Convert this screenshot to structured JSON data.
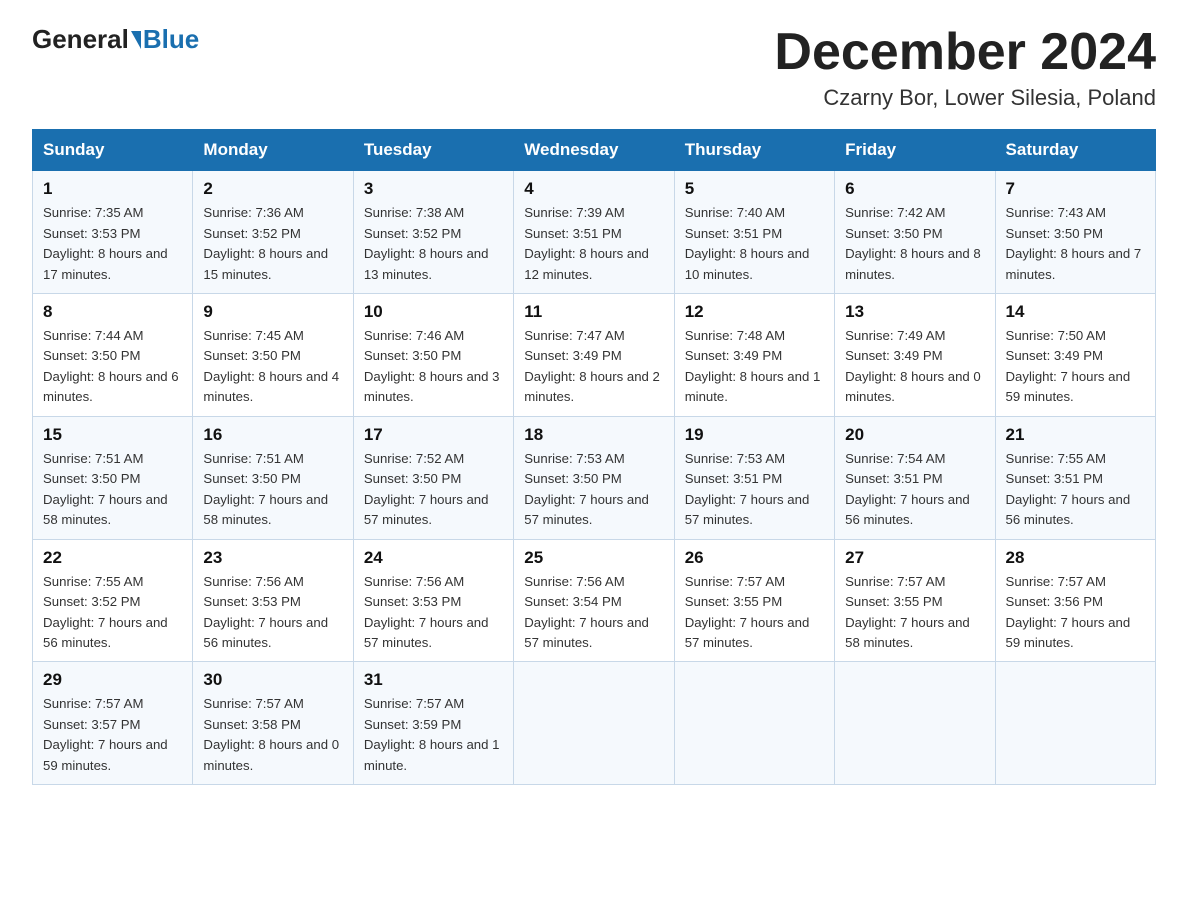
{
  "logo": {
    "general": "General",
    "blue": "Blue"
  },
  "title": "December 2024",
  "subtitle": "Czarny Bor, Lower Silesia, Poland",
  "weekdays": [
    "Sunday",
    "Monday",
    "Tuesday",
    "Wednesday",
    "Thursday",
    "Friday",
    "Saturday"
  ],
  "weeks": [
    [
      {
        "day": "1",
        "sunrise": "7:35 AM",
        "sunset": "3:53 PM",
        "daylight": "8 hours and 17 minutes."
      },
      {
        "day": "2",
        "sunrise": "7:36 AM",
        "sunset": "3:52 PM",
        "daylight": "8 hours and 15 minutes."
      },
      {
        "day": "3",
        "sunrise": "7:38 AM",
        "sunset": "3:52 PM",
        "daylight": "8 hours and 13 minutes."
      },
      {
        "day": "4",
        "sunrise": "7:39 AM",
        "sunset": "3:51 PM",
        "daylight": "8 hours and 12 minutes."
      },
      {
        "day": "5",
        "sunrise": "7:40 AM",
        "sunset": "3:51 PM",
        "daylight": "8 hours and 10 minutes."
      },
      {
        "day": "6",
        "sunrise": "7:42 AM",
        "sunset": "3:50 PM",
        "daylight": "8 hours and 8 minutes."
      },
      {
        "day": "7",
        "sunrise": "7:43 AM",
        "sunset": "3:50 PM",
        "daylight": "8 hours and 7 minutes."
      }
    ],
    [
      {
        "day": "8",
        "sunrise": "7:44 AM",
        "sunset": "3:50 PM",
        "daylight": "8 hours and 6 minutes."
      },
      {
        "day": "9",
        "sunrise": "7:45 AM",
        "sunset": "3:50 PM",
        "daylight": "8 hours and 4 minutes."
      },
      {
        "day": "10",
        "sunrise": "7:46 AM",
        "sunset": "3:50 PM",
        "daylight": "8 hours and 3 minutes."
      },
      {
        "day": "11",
        "sunrise": "7:47 AM",
        "sunset": "3:49 PM",
        "daylight": "8 hours and 2 minutes."
      },
      {
        "day": "12",
        "sunrise": "7:48 AM",
        "sunset": "3:49 PM",
        "daylight": "8 hours and 1 minute."
      },
      {
        "day": "13",
        "sunrise": "7:49 AM",
        "sunset": "3:49 PM",
        "daylight": "8 hours and 0 minutes."
      },
      {
        "day": "14",
        "sunrise": "7:50 AM",
        "sunset": "3:49 PM",
        "daylight": "7 hours and 59 minutes."
      }
    ],
    [
      {
        "day": "15",
        "sunrise": "7:51 AM",
        "sunset": "3:50 PM",
        "daylight": "7 hours and 58 minutes."
      },
      {
        "day": "16",
        "sunrise": "7:51 AM",
        "sunset": "3:50 PM",
        "daylight": "7 hours and 58 minutes."
      },
      {
        "day": "17",
        "sunrise": "7:52 AM",
        "sunset": "3:50 PM",
        "daylight": "7 hours and 57 minutes."
      },
      {
        "day": "18",
        "sunrise": "7:53 AM",
        "sunset": "3:50 PM",
        "daylight": "7 hours and 57 minutes."
      },
      {
        "day": "19",
        "sunrise": "7:53 AM",
        "sunset": "3:51 PM",
        "daylight": "7 hours and 57 minutes."
      },
      {
        "day": "20",
        "sunrise": "7:54 AM",
        "sunset": "3:51 PM",
        "daylight": "7 hours and 56 minutes."
      },
      {
        "day": "21",
        "sunrise": "7:55 AM",
        "sunset": "3:51 PM",
        "daylight": "7 hours and 56 minutes."
      }
    ],
    [
      {
        "day": "22",
        "sunrise": "7:55 AM",
        "sunset": "3:52 PM",
        "daylight": "7 hours and 56 minutes."
      },
      {
        "day": "23",
        "sunrise": "7:56 AM",
        "sunset": "3:53 PM",
        "daylight": "7 hours and 56 minutes."
      },
      {
        "day": "24",
        "sunrise": "7:56 AM",
        "sunset": "3:53 PM",
        "daylight": "7 hours and 57 minutes."
      },
      {
        "day": "25",
        "sunrise": "7:56 AM",
        "sunset": "3:54 PM",
        "daylight": "7 hours and 57 minutes."
      },
      {
        "day": "26",
        "sunrise": "7:57 AM",
        "sunset": "3:55 PM",
        "daylight": "7 hours and 57 minutes."
      },
      {
        "day": "27",
        "sunrise": "7:57 AM",
        "sunset": "3:55 PM",
        "daylight": "7 hours and 58 minutes."
      },
      {
        "day": "28",
        "sunrise": "7:57 AM",
        "sunset": "3:56 PM",
        "daylight": "7 hours and 59 minutes."
      }
    ],
    [
      {
        "day": "29",
        "sunrise": "7:57 AM",
        "sunset": "3:57 PM",
        "daylight": "7 hours and 59 minutes."
      },
      {
        "day": "30",
        "sunrise": "7:57 AM",
        "sunset": "3:58 PM",
        "daylight": "8 hours and 0 minutes."
      },
      {
        "day": "31",
        "sunrise": "7:57 AM",
        "sunset": "3:59 PM",
        "daylight": "8 hours and 1 minute."
      },
      null,
      null,
      null,
      null
    ]
  ]
}
